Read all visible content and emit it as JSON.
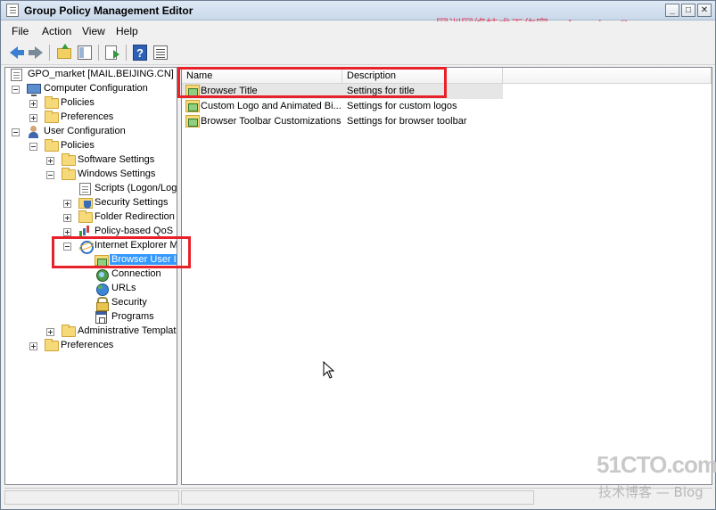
{
  "window": {
    "title": "Group Policy Management Editor",
    "watermark_cn": "网训网络技术工作室",
    "watermark_mail": "loveunicom@msn.com",
    "buttons": [
      "_",
      "□",
      "✕"
    ]
  },
  "menu": {
    "items": [
      "File",
      "Action",
      "View",
      "Help"
    ]
  },
  "toolbar": {
    "buttons": [
      "back-arrow-icon",
      "forward-arrow-icon",
      "up-folder-icon",
      "show-hide-tree-icon",
      "export-list-icon",
      "help-icon",
      "properties-icon"
    ]
  },
  "tree": {
    "root": "GPO_market [MAIL.BEIJING.CN] Po",
    "computer_config": "Computer Configuration",
    "cc_policies": "Policies",
    "cc_preferences": "Preferences",
    "user_config": "User Configuration",
    "uc_policies": "Policies",
    "software_settings": "Software Settings",
    "windows_settings": "Windows Settings",
    "scripts": "Scripts (Logon/Logo",
    "security_settings": "Security Settings",
    "folder_redirection": "Folder Redirection",
    "policy_qos": "Policy-based QoS",
    "ie_maintenance": "Internet Explorer M",
    "browser_ui": "Browser User I",
    "connection": "Connection",
    "urls": "URLs",
    "security": "Security",
    "programs": "Programs",
    "admin_templates": "Administrative Templat",
    "uc_preferences": "Preferences"
  },
  "list": {
    "columns": [
      "Name",
      "Description"
    ],
    "rows": [
      {
        "name": "Browser Title",
        "description": "Settings for title"
      },
      {
        "name": "Custom Logo and Animated Bi...",
        "description": "Settings for custom logos"
      },
      {
        "name": "Browser Toolbar Customizations",
        "description": "Settings for browser toolbar"
      }
    ]
  },
  "branding": {
    "logo_51": "51CTO.com",
    "logo_blog": "技术博客 — Blog"
  },
  "colors": {
    "highlight_box": "#e8222a",
    "selection": "#3399ff",
    "watermark": "#e0506b"
  }
}
